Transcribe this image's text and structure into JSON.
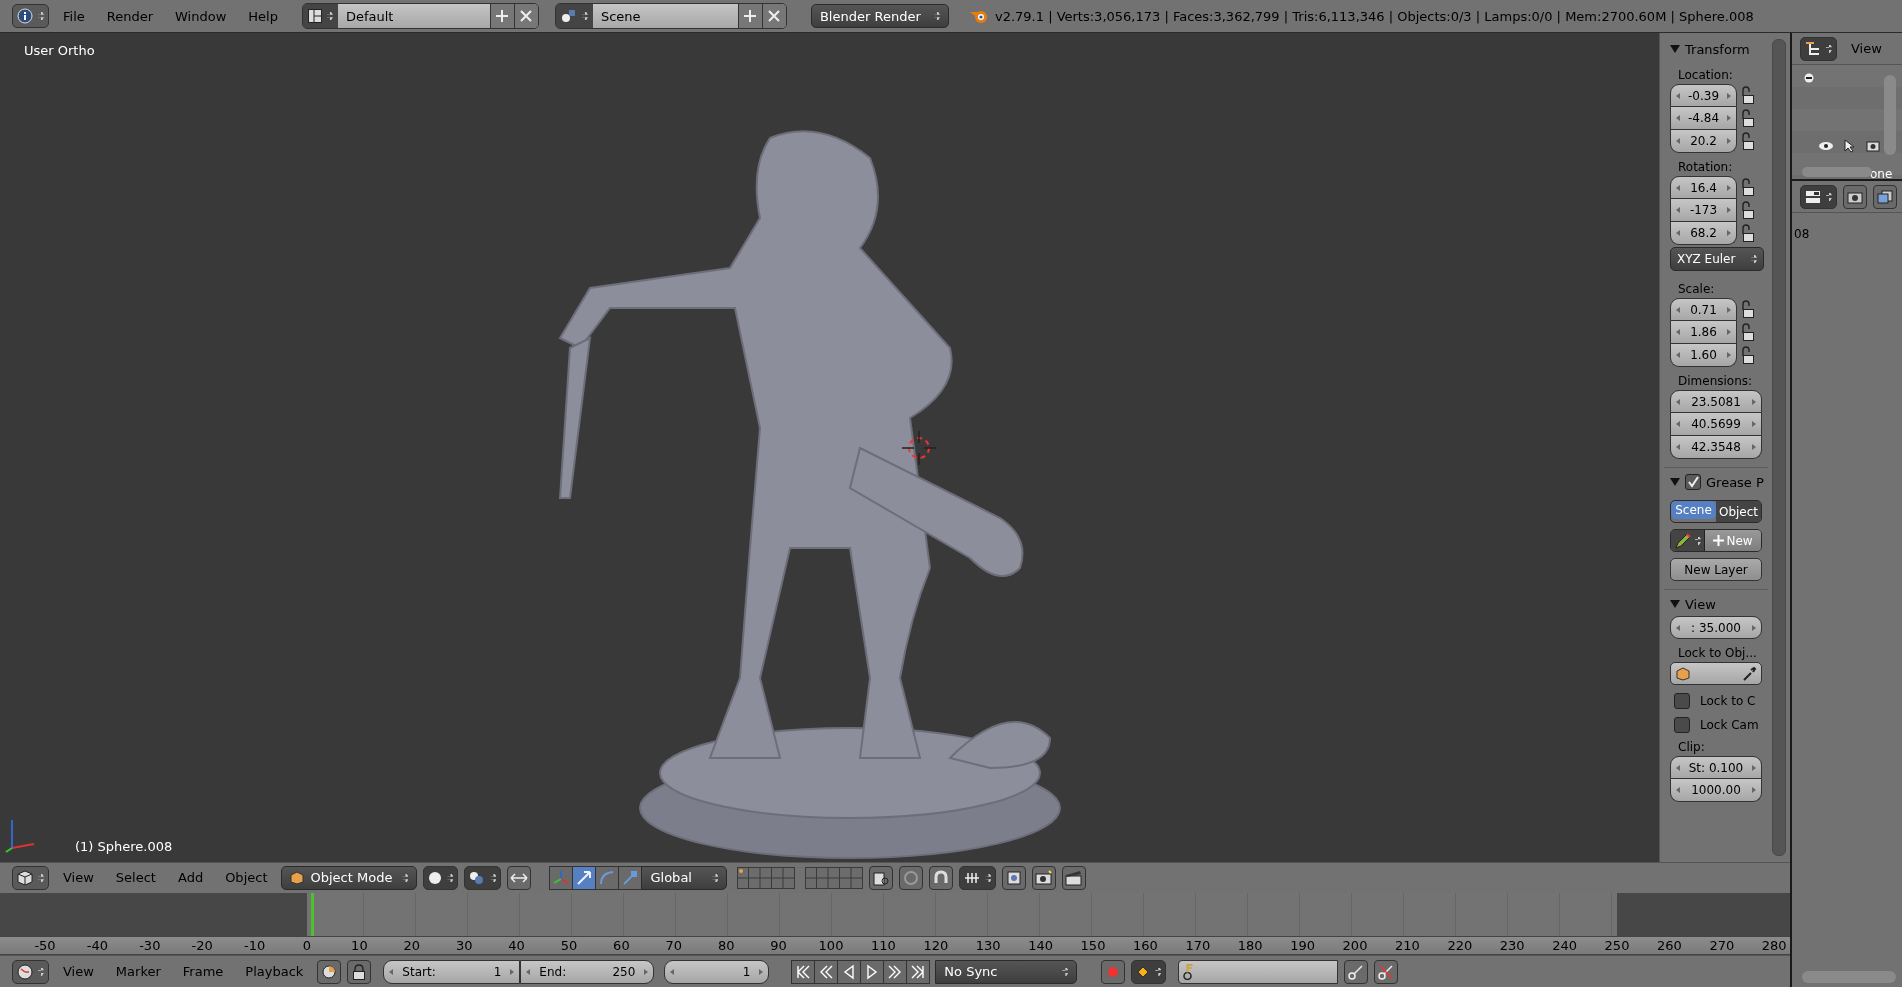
{
  "top_bar": {
    "menus": [
      "File",
      "Render",
      "Window",
      "Help"
    ],
    "screen_layout": "Default",
    "scene": "Scene",
    "render_engine": "Blender Render",
    "stats": "v2.79.1 | Verts:3,056,173 | Faces:3,362,799 | Tris:6,113,346 | Objects:0/3 | Lamps:0/0 | Mem:2700.60M | Sphere.008"
  },
  "viewport": {
    "view_name": "User Ortho",
    "object_label": "(1) Sphere.008"
  },
  "n_panel": {
    "transform": {
      "title": "Transform",
      "groups": [
        {
          "label": "Location:",
          "fields": [
            {
              "value": "-0.39",
              "locked": false
            },
            {
              "value": "-4.84",
              "locked": false
            },
            {
              "value": "20.2",
              "locked": false
            }
          ]
        },
        {
          "label": "Rotation:",
          "fields": [
            {
              "value": "16.4",
              "locked": false
            },
            {
              "value": "-173",
              "locked": false
            },
            {
              "value": "68.2",
              "locked": false
            }
          ]
        }
      ],
      "rotation_mode": "XYZ Euler",
      "scale": {
        "label": "Scale:",
        "fields": [
          {
            "value": "0.71",
            "locked": false
          },
          {
            "value": "1.86",
            "locked": false
          },
          {
            "value": "1.60",
            "locked": false
          }
        ]
      },
      "dimensions": {
        "label": "Dimensions:",
        "fields": [
          "23.5081",
          "40.5699",
          "42.3548"
        ]
      }
    },
    "grease_pencil": {
      "title": "Grease P",
      "enabled": true,
      "sources": [
        {
          "label": "Scene",
          "selected": true
        },
        {
          "label": "Object",
          "selected": false
        }
      ],
      "new_button": "New",
      "new_layer_button": "New Layer"
    },
    "view": {
      "title": "View",
      "lens": ": 35.000",
      "lock_label": "Lock to Obj...",
      "checkboxes": [
        {
          "label": "Lock to C",
          "checked": false
        },
        {
          "label": "Lock Cam",
          "checked": false
        }
      ],
      "clip_label": "Clip:",
      "clip_start": "St: 0.100",
      "clip_end": "1000.00"
    }
  },
  "outliner": {
    "menu": "View",
    "partial_text": "one"
  },
  "properties": {
    "partial_text": "08"
  },
  "viewport_header": {
    "menus": [
      "View",
      "Select",
      "Add",
      "Object"
    ],
    "mode": "Object Mode",
    "manipulators": [
      {
        "kind": "translate",
        "selected": true
      },
      {
        "kind": "rotate",
        "selected": false
      },
      {
        "kind": "scale",
        "selected": false
      }
    ],
    "orientation": "Global"
  },
  "timeline": {
    "ticks": [
      "-50",
      "-40",
      "-30",
      "-20",
      "-10",
      "0",
      "10",
      "20",
      "30",
      "40",
      "50",
      "60",
      "70",
      "80",
      "90",
      "100",
      "110",
      "120",
      "130",
      "140",
      "150",
      "160",
      "170",
      "180",
      "190",
      "200",
      "210",
      "220",
      "230",
      "240",
      "250",
      "260",
      "270",
      "280"
    ],
    "menus": [
      "View",
      "Marker",
      "Frame",
      "Playback"
    ],
    "start": {
      "label": "Start:",
      "value": "1"
    },
    "end": {
      "label": "End:",
      "value": "250"
    },
    "current_frame": "1",
    "sync": "No Sync"
  }
}
